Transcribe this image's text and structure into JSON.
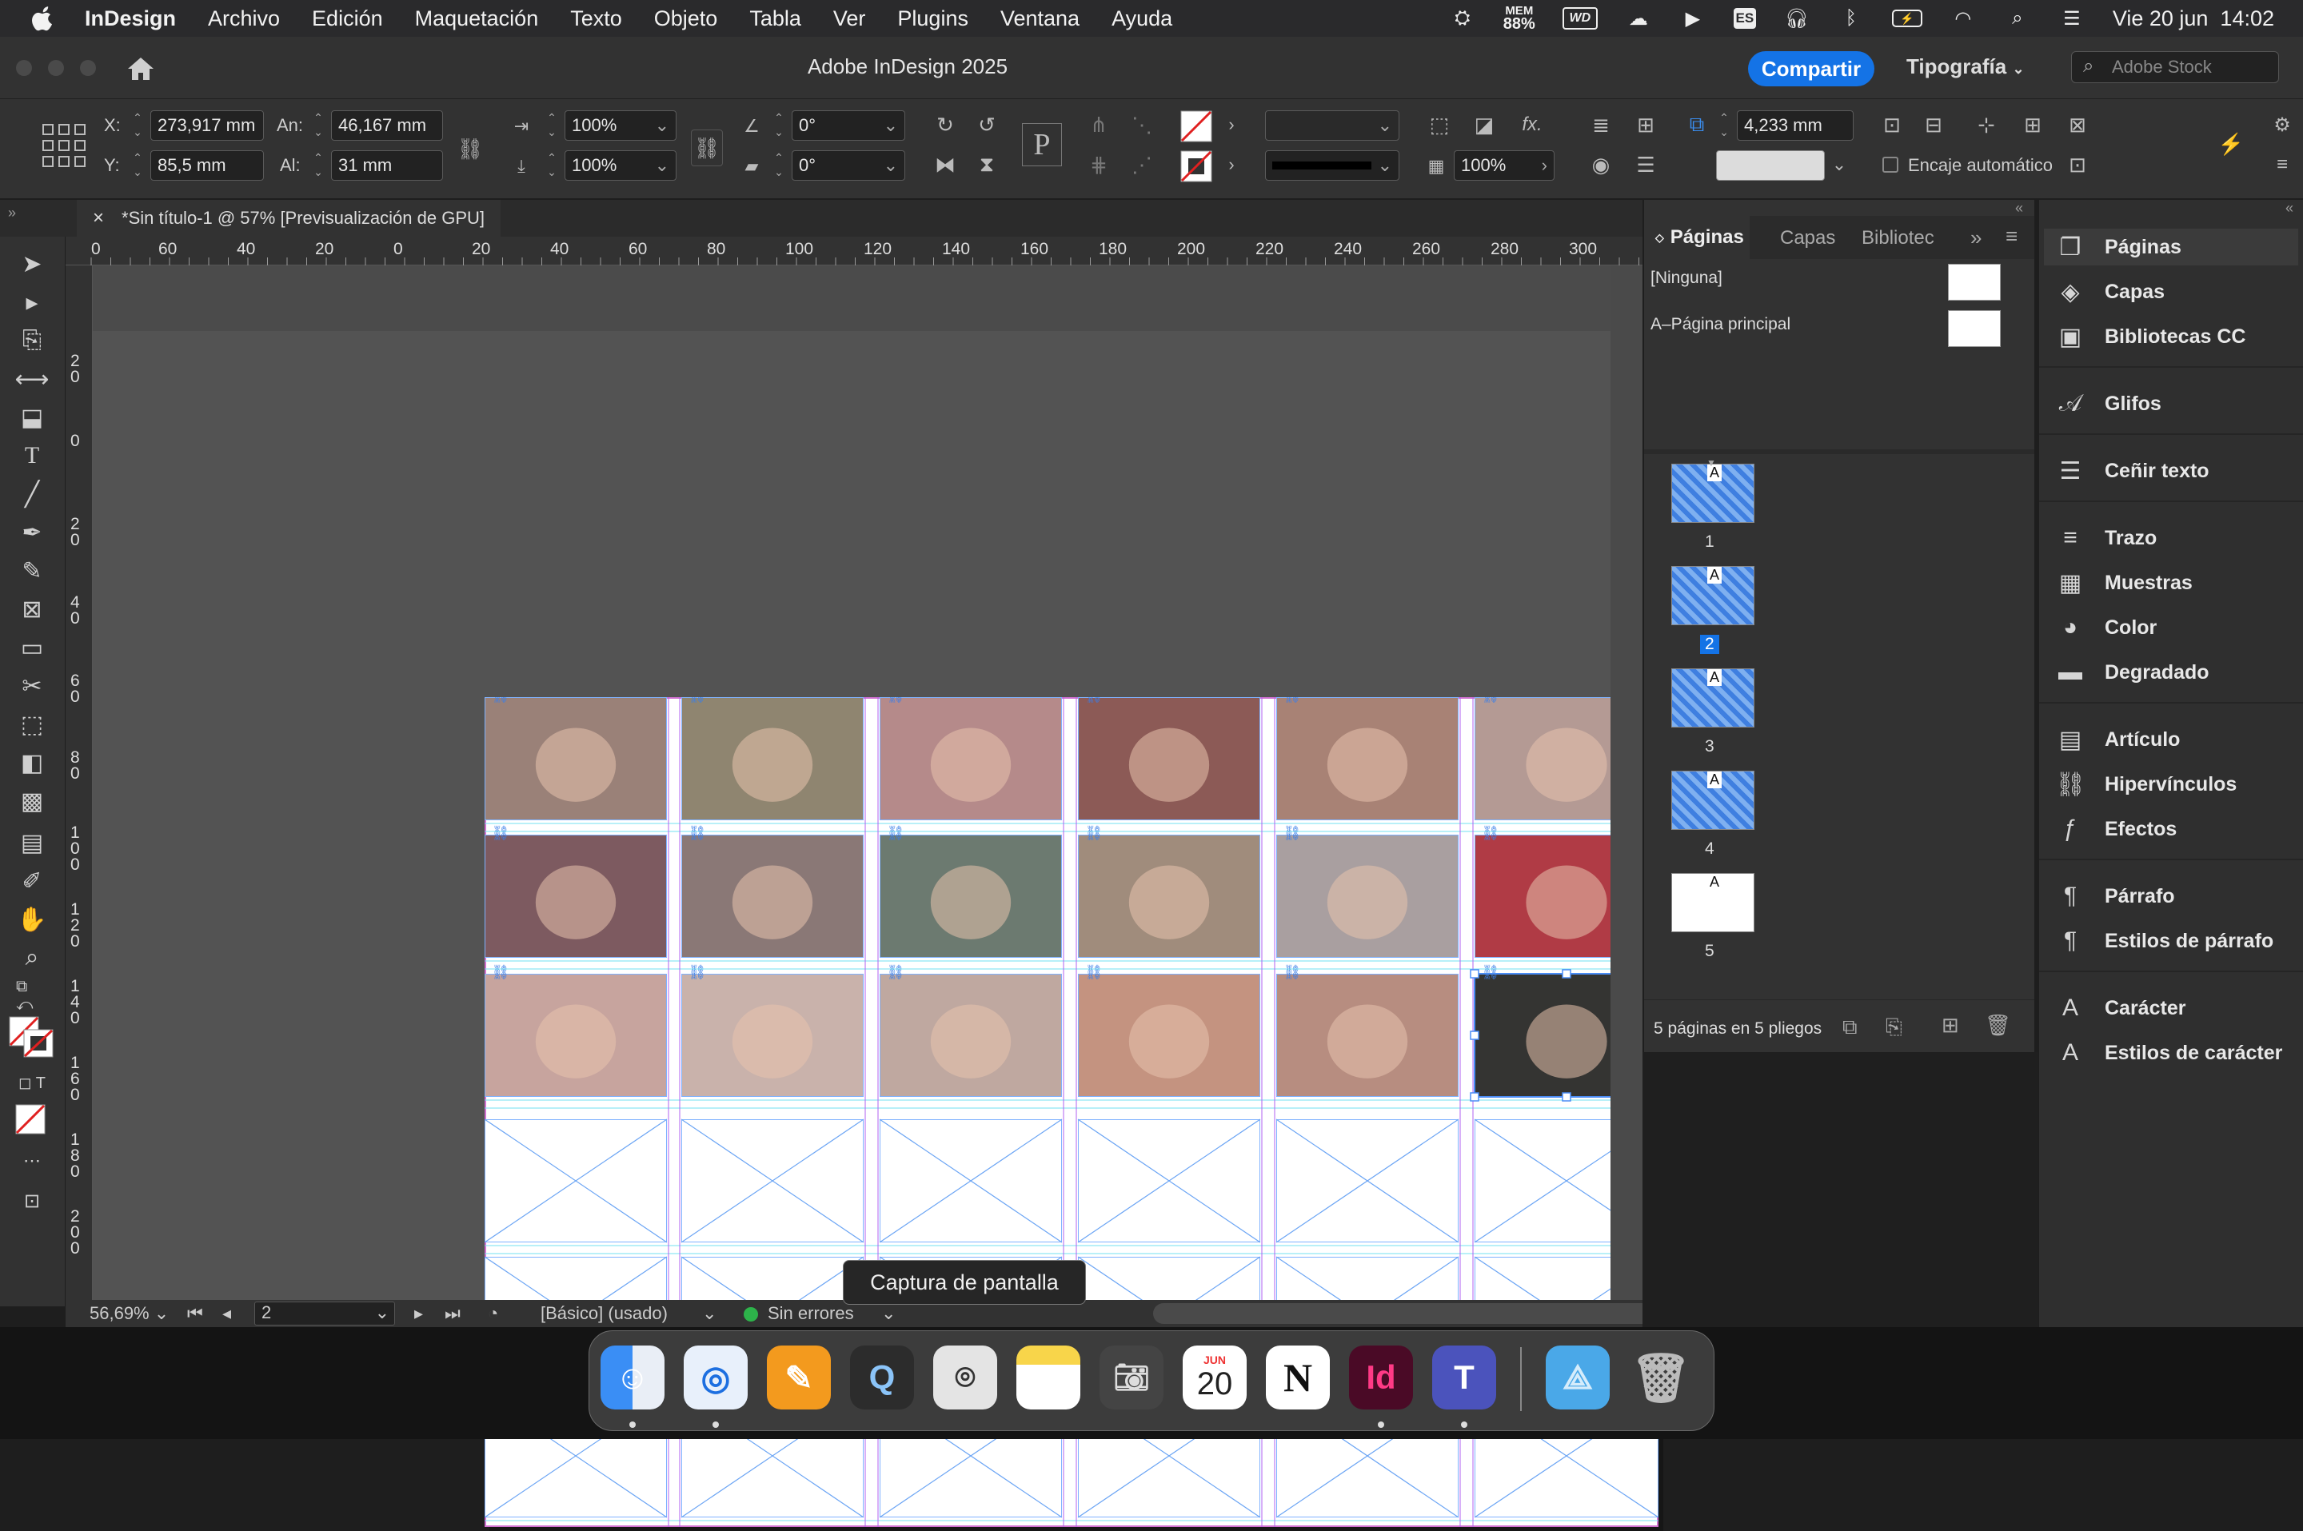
{
  "menubar": {
    "app": "InDesign",
    "items": [
      "Archivo",
      "Edición",
      "Maquetación",
      "Texto",
      "Objeto",
      "Tabla",
      "Ver",
      "Plugins",
      "Ventana",
      "Ayuda"
    ],
    "mem_label": "MEM",
    "mem_value": "88%",
    "wd_label": "WD",
    "input_source": "ES",
    "datetime": "Vie 20 jun  14:02"
  },
  "titlebar": {
    "title": "Adobe InDesign 2025",
    "share": "Compartir",
    "workspace": "Tipografía",
    "stock_placeholder": "Adobe Stock"
  },
  "control": {
    "x_label": "X:",
    "x_value": "273,917 mm",
    "y_label": "Y:",
    "y_value": "85,5 mm",
    "w_label": "An:",
    "w_value": "46,167 mm",
    "h_label": "Al:",
    "h_value": "31 mm",
    "scale_x": "100%",
    "scale_y": "100%",
    "rotate": "0°",
    "shear": "0°",
    "opacity": "100%",
    "gap_value": "4,233 mm",
    "auto_fit": "Encaje automático"
  },
  "doc_tab": {
    "title": "*Sin título-1 @ 57% [Previsualización de GPU]"
  },
  "rulers": {
    "h_ticks": [
      "0",
      "60",
      "40",
      "20",
      "0",
      "20",
      "40",
      "60",
      "80",
      "100",
      "120",
      "140",
      "160",
      "180",
      "200",
      "220",
      "240",
      "260",
      "280",
      "300"
    ],
    "v_ticks": [
      "2\n0",
      "0",
      "2\n0",
      "4\n0",
      "6\n0",
      "8\n0",
      "1\n0\n0",
      "1\n2\n0",
      "1\n4\n0",
      "1\n6\n0",
      "1\n8\n0",
      "2\n0\n0"
    ]
  },
  "photo_colors": [
    [
      "#9a8178",
      "#8f8570",
      "#b58a8a",
      "#8c5a56",
      "#a88275",
      "#b49a94"
    ],
    [
      "#7d5a60",
      "#8a7876",
      "#6c7a70",
      "#a08c7c",
      "#a99fa0",
      "#b03b45"
    ],
    [
      "#c7a49e",
      "#c9b2ab",
      "#bfa8a0",
      "#c49380",
      "#b78d80",
      "#343432"
    ]
  ],
  "status": {
    "zoom": "56,69%",
    "page": "2",
    "style": "[Básico] (usado)",
    "preflight": "Sin errores"
  },
  "pages_panel": {
    "tabs": [
      "Páginas",
      "Capas",
      "Bibliotec"
    ],
    "masters": [
      "[Ninguna]",
      "A–Página principal"
    ],
    "pages": [
      {
        "num": "1",
        "master": "A"
      },
      {
        "num": "2",
        "master": "A"
      },
      {
        "num": "3",
        "master": "A"
      },
      {
        "num": "4",
        "master": "A"
      },
      {
        "num": "5",
        "master": "A"
      }
    ],
    "footer": "5 páginas en 5 pliegos"
  },
  "right_panel": {
    "items": [
      {
        "label": "Páginas",
        "icon": "pages-icon"
      },
      {
        "label": "Capas",
        "icon": "layers-icon"
      },
      {
        "label": "Bibliotecas CC",
        "icon": "libraries-icon"
      },
      {
        "label": "Glifos",
        "icon": "glyphs-icon"
      },
      {
        "label": "Ceñir texto",
        "icon": "text-wrap-icon"
      },
      {
        "label": "Trazo",
        "icon": "stroke-icon"
      },
      {
        "label": "Muestras",
        "icon": "swatches-icon"
      },
      {
        "label": "Color",
        "icon": "color-icon"
      },
      {
        "label": "Degradado",
        "icon": "gradient-icon"
      },
      {
        "label": "Artículo",
        "icon": "article-icon"
      },
      {
        "label": "Hipervínculos",
        "icon": "hyperlinks-icon"
      },
      {
        "label": "Efectos",
        "icon": "effects-icon"
      },
      {
        "label": "Párrafo",
        "icon": "paragraph-icon"
      },
      {
        "label": "Estilos de párrafo",
        "icon": "paragraph-styles-icon"
      },
      {
        "label": "Carácter",
        "icon": "character-icon"
      },
      {
        "label": "Estilos de carácter",
        "icon": "character-styles-icon"
      }
    ]
  },
  "tooltip": "Captura de pantalla",
  "dock": {
    "calendar_month": "JUN",
    "calendar_day": "20",
    "indesign": "Id"
  }
}
